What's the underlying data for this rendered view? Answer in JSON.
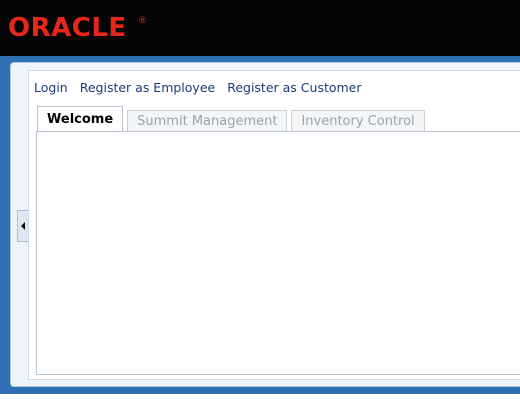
{
  "branding": {
    "logo_text": "ORACLE",
    "logo_mark": "®"
  },
  "nav": {
    "links": [
      {
        "label": "Login"
      },
      {
        "label": "Register as Employee"
      },
      {
        "label": "Register as Customer"
      }
    ]
  },
  "tabs": [
    {
      "label": "Welcome",
      "active": true
    },
    {
      "label": "Summit Management",
      "active": false
    },
    {
      "label": "Inventory Control",
      "active": false
    }
  ],
  "colors": {
    "header_bg": "#050505",
    "logo_red": "#e8261c",
    "frame_blue": "#2f6fb3",
    "link_blue": "#1a3c78"
  },
  "icons": {
    "collapse_handle": "chevron-left-icon"
  }
}
